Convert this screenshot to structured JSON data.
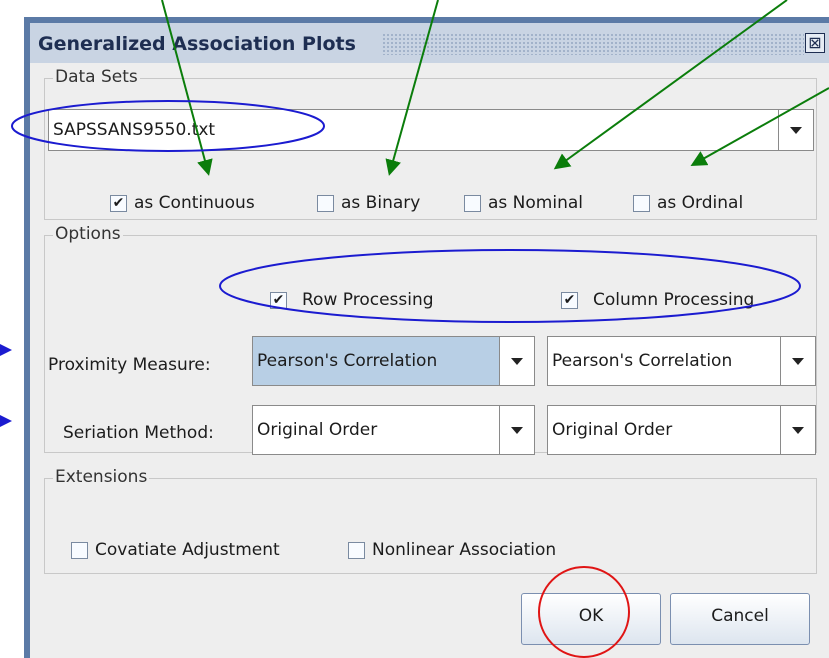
{
  "dialog": {
    "title": "Generalized Association Plots",
    "close_glyph": "⊠"
  },
  "data_sets": {
    "legend": "Data Sets",
    "selected_file": "SAPSSANS9550.txt",
    "checkboxes": [
      {
        "label": "as Continuous",
        "checked": true
      },
      {
        "label": "as Binary",
        "checked": false
      },
      {
        "label": "as Nominal",
        "checked": false
      },
      {
        "label": "as Ordinal",
        "checked": false
      }
    ]
  },
  "options": {
    "legend": "Options",
    "row_processing": {
      "label": "Row Processing",
      "checked": true
    },
    "column_processing": {
      "label": "Column Processing",
      "checked": true
    },
    "proximity_label": "Proximity Measure:",
    "proximity_row": "Pearson's Correlation",
    "proximity_col": "Pearson's Correlation",
    "seriation_label": "Seriation Method:",
    "seriation_row": "Original Order",
    "seriation_col": "Original Order"
  },
  "extensions": {
    "legend": "Extensions",
    "covariate": {
      "label": "Covatiate Adjustment",
      "checked": false
    },
    "nonlinear": {
      "label": "Nonlinear Association",
      "checked": false
    }
  },
  "buttons": {
    "ok": "OK",
    "cancel": "Cancel"
  },
  "check_glyph": "✔",
  "colors": {
    "title_text": "#1e2e52",
    "annotation_blue": "#1b1bd0",
    "annotation_green": "#0b7d0b",
    "annotation_red": "#e01515"
  }
}
